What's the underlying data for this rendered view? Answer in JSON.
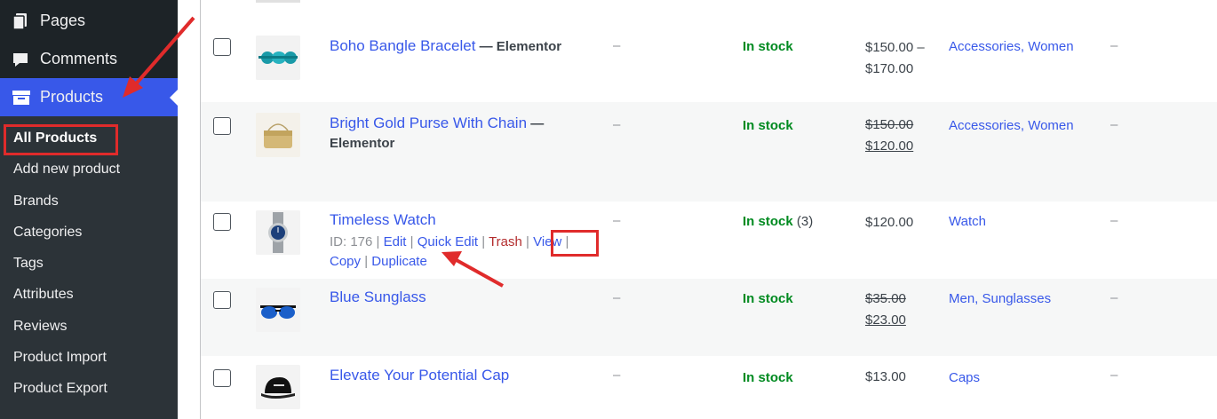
{
  "sidebar": {
    "menu": [
      {
        "label": "Pages",
        "icon": "pages-icon"
      },
      {
        "label": "Comments",
        "icon": "comment-icon"
      },
      {
        "label": "Products",
        "icon": "archive-icon"
      }
    ],
    "submenu": [
      {
        "label": "All Products",
        "current": true
      },
      {
        "label": "Add new product"
      },
      {
        "label": "Brands"
      },
      {
        "label": "Categories"
      },
      {
        "label": "Tags"
      },
      {
        "label": "Attributes"
      },
      {
        "label": "Reviews"
      },
      {
        "label": "Product Import"
      },
      {
        "label": "Product Export"
      }
    ]
  },
  "colors": {
    "sidebar_bg": "#1d2327",
    "active_menu": "#3858e9",
    "link": "#3858e9",
    "in_stock": "#008a20",
    "annotation_red": "#e02b2b"
  },
  "products": [
    {
      "name": "Boho Bangle Bracelet",
      "suffix": "— Elementor",
      "sku": "–",
      "stock": "In stock",
      "stock_qty": "",
      "price": "$150.00 –",
      "price_line2": "$170.00",
      "categories": "Accessories, Women",
      "tags": "–",
      "thumb": "bracelet"
    },
    {
      "name": "Bright Gold Purse With Chain",
      "suffix": "—",
      "suffix_line2": "Elementor",
      "sku": "–",
      "stock": "In stock",
      "stock_qty": "",
      "regular_price": "$150.00",
      "sale_price": "$120.00",
      "categories": "Accessories, Women",
      "tags": "–",
      "thumb": "purse"
    },
    {
      "name": "Timeless Watch",
      "sku": "–",
      "stock": "In stock",
      "stock_qty": "(3)",
      "price": "$120.00",
      "categories": "Watch",
      "tags": "–",
      "thumb": "watch",
      "row_actions": {
        "id": "ID: 176",
        "edit": "Edit",
        "quick_edit": "Quick Edit",
        "trash": "Trash",
        "view": "View",
        "copy": "Copy",
        "duplicate": "Duplicate"
      }
    },
    {
      "name": "Blue Sunglass",
      "sku": "–",
      "stock": "In stock",
      "stock_qty": "",
      "regular_price": "$35.00",
      "sale_price": "$23.00",
      "categories": "Men, Sunglasses",
      "tags": "–",
      "thumb": "sunglasses"
    },
    {
      "name": "Elevate Your Potential Cap",
      "sku": "–",
      "stock": "In stock",
      "stock_qty": "",
      "price": "$13.00",
      "categories": "Caps",
      "tags": "–",
      "thumb": "cap"
    }
  ]
}
